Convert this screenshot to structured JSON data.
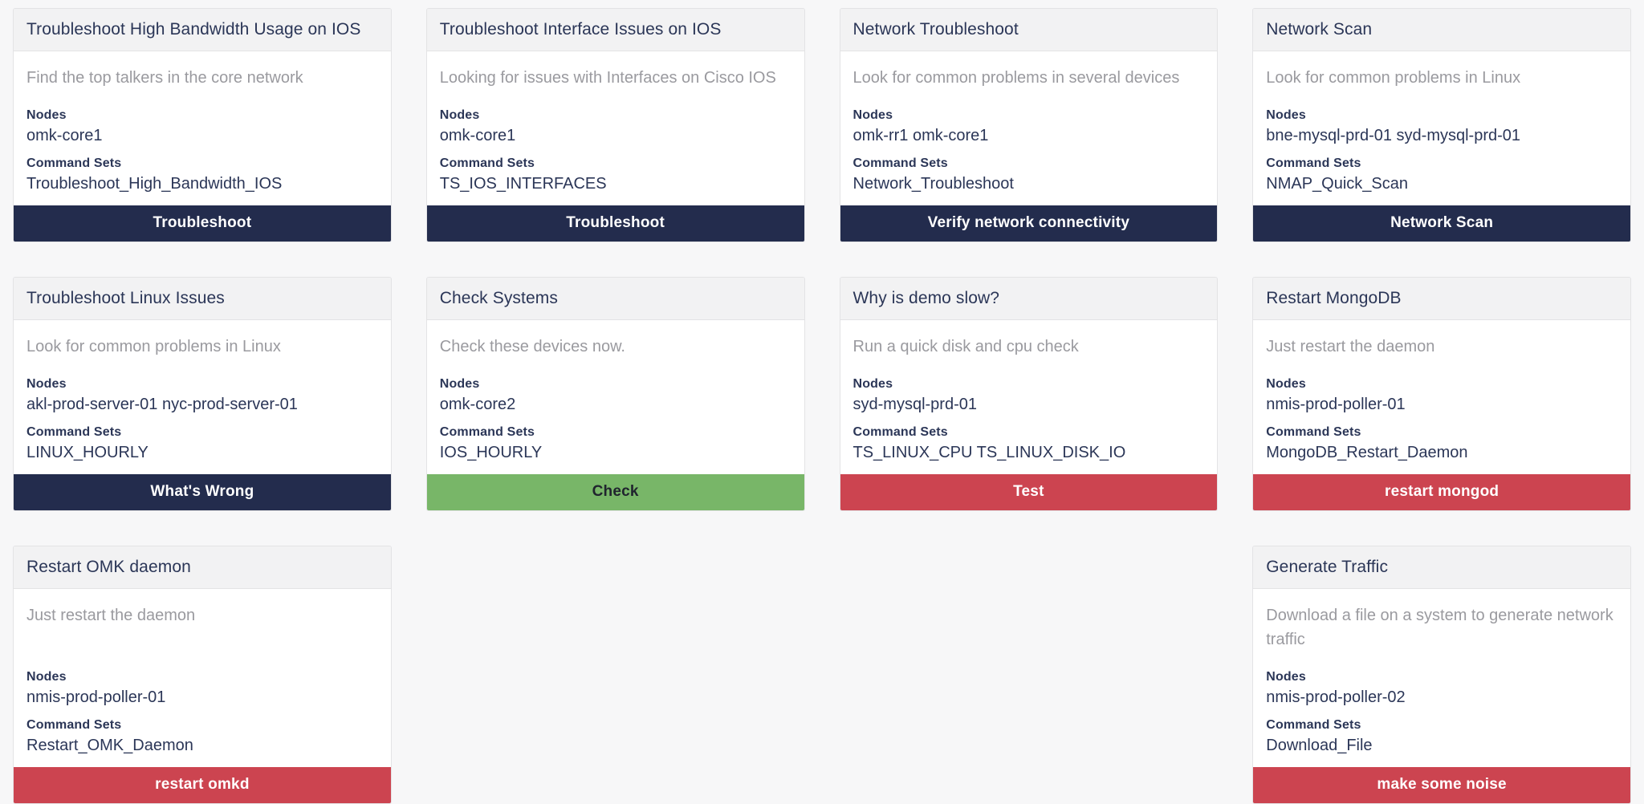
{
  "labels": {
    "nodes": "Nodes",
    "command_sets": "Command Sets"
  },
  "colors": {
    "navy": "#232c4d",
    "green": "#78b668",
    "red": "#cc4450",
    "card_header_bg": "#f2f2f3",
    "card_border": "#e3e3e5",
    "page_bg": "#f7f7f8",
    "title_text": "#2b3657",
    "desc_text": "#9a9a9f"
  },
  "cards": [
    {
      "title": "Troubleshoot High Bandwidth Usage on IOS",
      "description": "Find the top talkers in the core network",
      "nodes": "omk-core1",
      "command_sets": "Troubleshoot_High_Bandwidth_IOS",
      "action_label": "Troubleshoot",
      "action_style": "navy",
      "desc_lines": 1
    },
    {
      "title": "Troubleshoot Interface Issues on IOS",
      "description": "Looking for issues with Interfaces on Cisco IOS",
      "nodes": "omk-core1",
      "command_sets": "TS_IOS_INTERFACES",
      "action_label": "Troubleshoot",
      "action_style": "navy",
      "desc_lines": 1
    },
    {
      "title": "Network Troubleshoot",
      "description": "Look for common problems in several devices",
      "nodes": "omk-rr1 omk-core1",
      "command_sets": "Network_Troubleshoot",
      "action_label": "Verify network connectivity",
      "action_style": "navy",
      "desc_lines": 1
    },
    {
      "title": "Network Scan",
      "description": "Look for common problems in Linux",
      "nodes": "bne-mysql-prd-01 syd-mysql-prd-01",
      "command_sets": "NMAP_Quick_Scan",
      "action_label": "Network Scan",
      "action_style": "navy",
      "desc_lines": 1
    },
    {
      "title": "Troubleshoot Linux Issues",
      "description": "Look for common problems in Linux",
      "nodes": "akl-prod-server-01 nyc-prod-server-01",
      "command_sets": "LINUX_HOURLY",
      "action_label": "What's Wrong",
      "action_style": "navy",
      "desc_lines": 1
    },
    {
      "title": "Check Systems",
      "description": "Check these devices now.",
      "nodes": "omk-core2",
      "command_sets": "IOS_HOURLY",
      "action_label": "Check",
      "action_style": "green",
      "desc_lines": 1
    },
    {
      "title": "Why is demo slow?",
      "description": "Run a quick disk and cpu check",
      "nodes": "syd-mysql-prd-01",
      "command_sets": "TS_LINUX_CPU TS_LINUX_DISK_IO",
      "action_label": "Test",
      "action_style": "red",
      "desc_lines": 1
    },
    {
      "title": "Restart MongoDB",
      "description": "Just restart the daemon",
      "nodes": "nmis-prod-poller-01",
      "command_sets": "MongoDB_Restart_Daemon",
      "action_label": "restart mongod",
      "action_style": "red",
      "desc_lines": 1
    },
    {
      "title": "Restart OMK daemon",
      "description": "Just restart the daemon",
      "nodes": "nmis-prod-poller-01",
      "command_sets": "Restart_OMK_Daemon",
      "action_label": "restart omkd",
      "action_style": "red",
      "desc_lines": 2
    },
    null,
    null,
    {
      "title": "Generate Traffic",
      "description": "Download a file on a system to generate network traffic",
      "nodes": "nmis-prod-poller-02",
      "command_sets": "Download_File",
      "action_label": "make some noise",
      "action_style": "red",
      "desc_lines": 2
    }
  ]
}
